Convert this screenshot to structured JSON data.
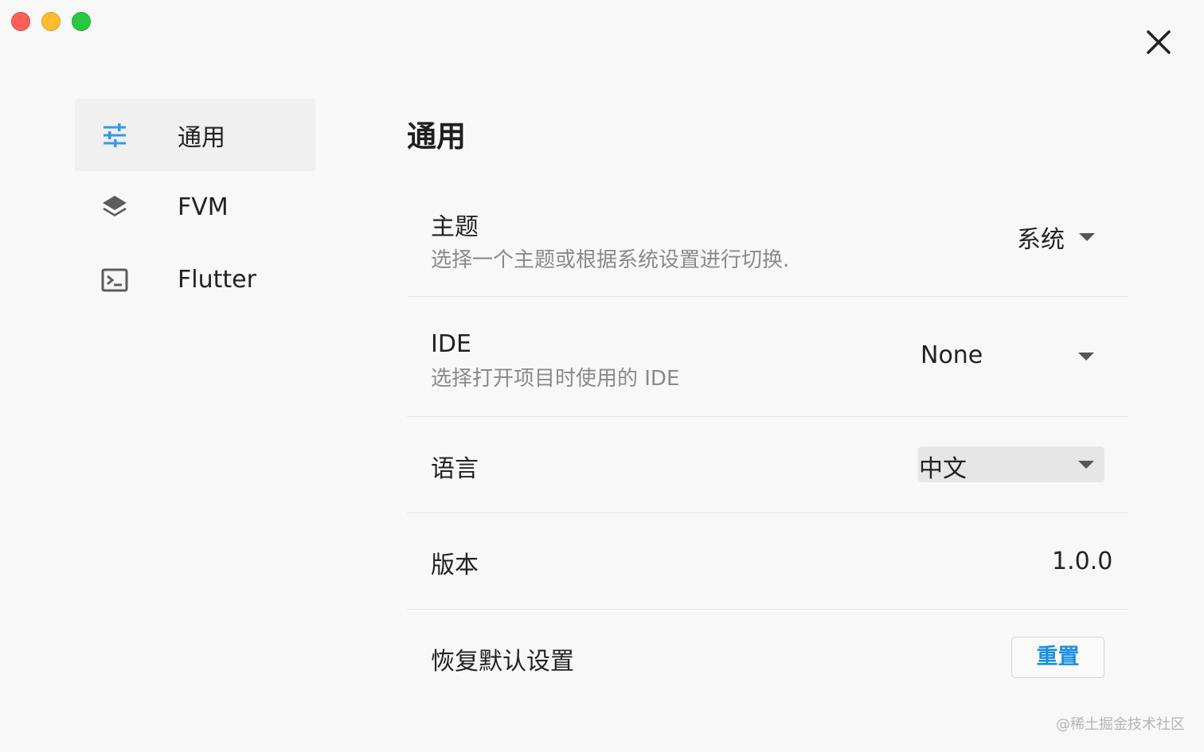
{
  "window": {
    "close_icon": "close-icon"
  },
  "sidebar": {
    "items": [
      {
        "label": "通用",
        "icon": "sliders-icon",
        "active": true
      },
      {
        "label": "FVM",
        "icon": "layers-icon",
        "active": false
      },
      {
        "label": "Flutter",
        "icon": "terminal-icon",
        "active": false
      }
    ]
  },
  "main": {
    "title": "通用",
    "settings": {
      "theme": {
        "title": "主题",
        "subtitle": "选择一个主题或根据系统设置进行切换.",
        "value": "系统"
      },
      "ide": {
        "title": "IDE",
        "subtitle": "选择打开项目时使用的 IDE",
        "value": "None"
      },
      "language": {
        "title": "语言",
        "value": "中文"
      },
      "version": {
        "title": "版本",
        "value": "1.0.0"
      },
      "reset": {
        "title": "恢复默认设置",
        "button_label": "重置"
      }
    }
  },
  "colors": {
    "accent": "#1a8fe8",
    "background": "#f8f8f8",
    "active_nav": "#f0f0f0",
    "dropdown_bg": "#e6e6e6"
  },
  "watermark": "@稀土掘金技术社区"
}
